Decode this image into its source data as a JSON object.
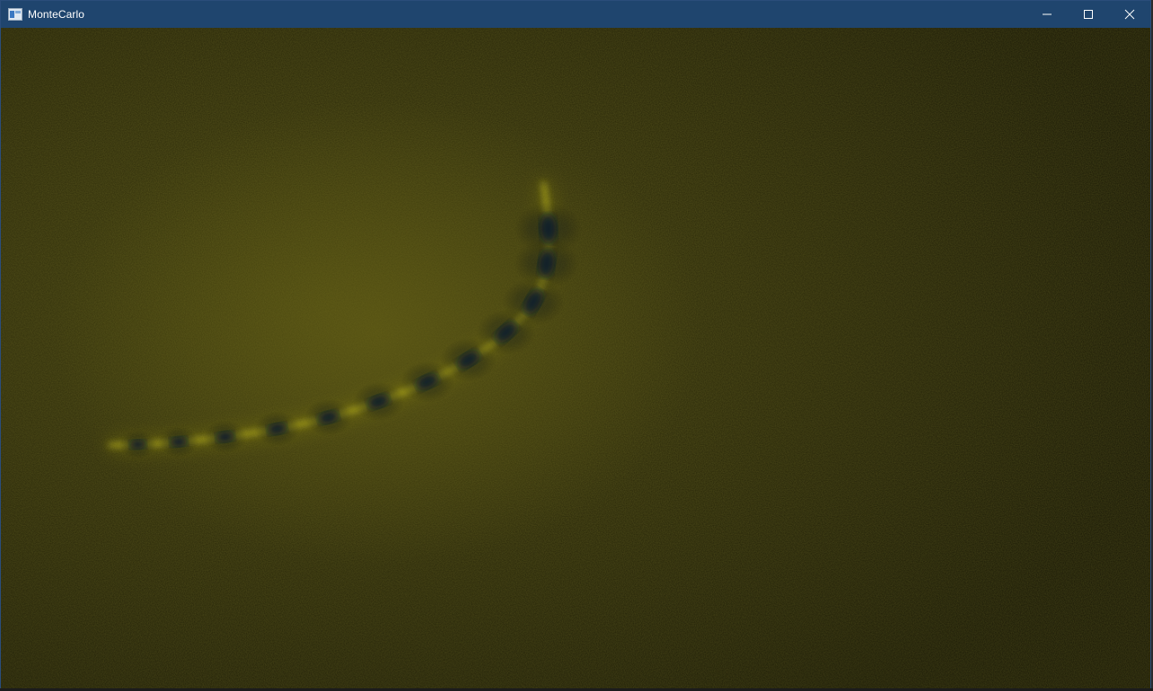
{
  "window": {
    "title": "MonteCarlo",
    "buttons": {
      "minimize_icon": "minimize-icon",
      "maximize_icon": "maximize-icon",
      "close_icon": "close-icon"
    },
    "colors": {
      "titlebar": "#1f456e",
      "border": "#2a4d7a"
    }
  },
  "render": {
    "background_color": "#1e1e0a",
    "glow_color": "#e8e21a",
    "particle_count": 13
  }
}
